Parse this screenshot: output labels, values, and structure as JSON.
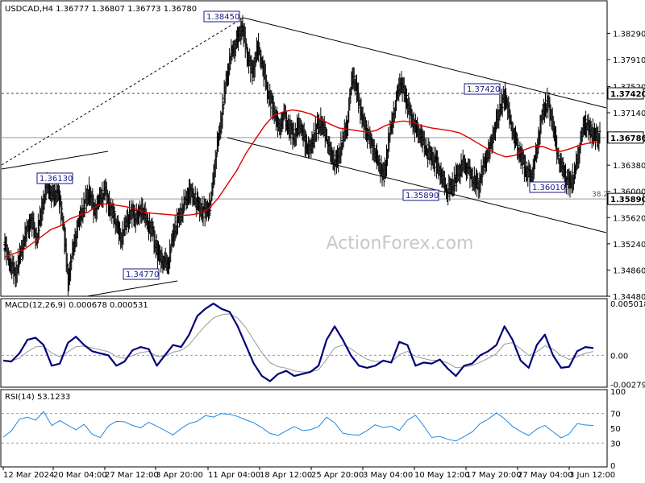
{
  "header": {
    "title": "USDCAD,H4  1.36777  1.36807  1.36773  1.36780",
    "watermark": "ActionForex.com"
  },
  "chart_data": [
    {
      "type": "candlestick",
      "title": "USDCAD,H4  1.36777  1.36807  1.36773  1.36780",
      "ylim": [
        1.3448,
        1.3875
      ],
      "y_ticks": [
        "1.38290",
        "1.37910",
        "1.37520",
        "1.37140",
        "1.36760",
        "1.36380",
        "1.36000",
        "1.35620",
        "1.35240",
        "1.34860",
        "1.34480"
      ],
      "x_ticks": [
        "12 Mar 2024",
        "20 Mar 04:00",
        "27 Mar 12:00",
        "3 Apr 20:00",
        "11 Apr 04:00",
        "18 Apr 12:00",
        "25 Apr 20:00",
        "3 May 04:00",
        "10 May 12:00",
        "17 May 20:00",
        "27 May 04:00",
        "3 Jun 12:00"
      ],
      "price_labels": [
        {
          "text": "1.38450",
          "value": 1.3845
        },
        {
          "text": "1.37420",
          "value": 1.3742
        },
        {
          "text": "1.36130",
          "value": 1.3613
        },
        {
          "text": "1.35890",
          "value": 1.3589
        },
        {
          "text": "1.36010",
          "value": 1.3601
        },
        {
          "text": "1.34770",
          "value": 1.3477
        }
      ],
      "right_tags": [
        {
          "text": "1.37420",
          "value": 1.3742
        },
        {
          "text": "1.36780",
          "value": 1.3678
        },
        {
          "text": "1.35890",
          "value": 1.3589
        }
      ],
      "fib_label": "38.2",
      "horizontal_lines": [
        {
          "value": 1.3742,
          "style": "dashed"
        },
        {
          "value": 1.3678,
          "style": "solid"
        },
        {
          "value": 1.3589,
          "style": "solid"
        }
      ],
      "close_series": [
        1.352,
        1.3495,
        1.348,
        1.351,
        1.354,
        1.356,
        1.353,
        1.3575,
        1.361,
        1.359,
        1.36,
        1.356,
        1.347,
        1.352,
        1.3555,
        1.358,
        1.36,
        1.357,
        1.359,
        1.36,
        1.3575,
        1.356,
        1.353,
        1.3555,
        1.357,
        1.356,
        1.3575,
        1.3555,
        1.354,
        1.351,
        1.35,
        1.3495,
        1.354,
        1.356,
        1.358,
        1.36,
        1.359,
        1.3575,
        1.357,
        1.358,
        1.365,
        1.37,
        1.376,
        1.38,
        1.3815,
        1.384,
        1.38,
        1.377,
        1.381,
        1.378,
        1.374,
        1.372,
        1.369,
        1.371,
        1.369,
        1.368,
        1.37,
        1.367,
        1.366,
        1.369,
        1.37,
        1.368,
        1.365,
        1.364,
        1.367,
        1.37,
        1.377,
        1.374,
        1.37,
        1.368,
        1.366,
        1.364,
        1.362,
        1.368,
        1.372,
        1.376,
        1.374,
        1.371,
        1.369,
        1.368,
        1.366,
        1.365,
        1.364,
        1.362,
        1.36,
        1.361,
        1.3625,
        1.364,
        1.363,
        1.3615,
        1.361,
        1.364,
        1.366,
        1.369,
        1.372,
        1.374,
        1.37,
        1.367,
        1.365,
        1.363,
        1.362,
        1.366,
        1.371,
        1.373,
        1.37,
        1.365,
        1.363,
        1.361,
        1.362,
        1.366,
        1.37,
        1.369,
        1.368,
        1.3678
      ],
      "ma_series": [
        1.3505,
        1.351,
        1.3515,
        1.3525,
        1.3535,
        1.3545,
        1.355,
        1.356,
        1.3565,
        1.357,
        1.358,
        1.3582,
        1.358,
        1.3578,
        1.3575,
        1.357,
        1.3568,
        1.3567,
        1.3566,
        1.3565,
        1.3566,
        1.3568,
        1.3575,
        1.359,
        1.361,
        1.363,
        1.3655,
        1.3675,
        1.3695,
        1.371,
        1.3715,
        1.3718,
        1.3716,
        1.3712,
        1.3705,
        1.3698,
        1.3692,
        1.369,
        1.3688,
        1.3686,
        1.3688,
        1.3695,
        1.37,
        1.3702,
        1.37,
        1.3695,
        1.3692,
        1.369,
        1.3688,
        1.3685,
        1.3678,
        1.367,
        1.3662,
        1.3655,
        1.365,
        1.3652,
        1.366,
        1.3665,
        1.3665,
        1.366,
        1.3658,
        1.3662,
        1.3667,
        1.367,
        1.3672
      ],
      "ma_x_range": [
        0.0,
        1.0
      ]
    },
    {
      "type": "line",
      "title": "MACD(12,26,9) 0.000678 0.000531",
      "ylim": [
        -0.003,
        0.0054
      ],
      "y_ticks": [
        "0.005018",
        "0.00",
        "-0.002795"
      ],
      "series": [
        {
          "values": [
            -0.0005,
            -0.0006,
            0.0002,
            0.0015,
            0.0017,
            0.001,
            -0.001,
            -0.0008,
            0.0012,
            0.0018,
            0.001,
            0.0004,
            0.0002,
            0.0,
            -0.001,
            -0.0006,
            0.0005,
            0.0008,
            0.0006,
            -0.001,
            0.0,
            0.001,
            0.0008,
            0.002,
            0.0038,
            0.0045,
            0.005,
            0.0045,
            0.0042,
            0.0028,
            0.001,
            -0.0008,
            -0.002,
            -0.0025,
            -0.0018,
            -0.0015,
            -0.002,
            -0.0018,
            -0.0016,
            -0.001,
            0.0015,
            0.0028,
            0.0015,
            0.0,
            -0.001,
            -0.0012,
            -0.001,
            -0.0005,
            -0.0007,
            0.0013,
            0.001,
            -0.001,
            -0.0007,
            -0.0008,
            -0.0004,
            -0.0013,
            -0.002,
            -0.001,
            -0.0008,
            0.0,
            0.0004,
            0.001,
            0.0028,
            0.0015,
            -0.0005,
            -0.0012,
            0.001,
            0.002,
            0.0,
            -0.0012,
            -0.0011,
            0.0004,
            0.0008,
            0.0007
          ]
        }
      ]
    },
    {
      "type": "line",
      "title": "RSI(14) 53.1233",
      "ylim": [
        0,
        100
      ],
      "y_ticks": [
        "100",
        "70",
        "50",
        "30",
        "0"
      ],
      "levels": [
        70,
        30
      ],
      "series": [
        {
          "values": [
            38,
            45,
            60,
            62,
            58,
            70,
            52,
            60,
            55,
            50,
            58,
            45,
            40,
            55,
            60,
            58,
            52,
            48,
            55,
            50,
            45,
            40,
            50,
            58,
            62,
            70,
            68,
            72,
            70,
            66,
            60,
            55,
            48,
            40,
            38,
            45,
            52,
            48,
            50,
            55,
            68,
            60,
            45,
            42,
            40,
            45,
            52,
            48,
            50,
            45,
            60,
            68,
            55,
            40,
            42,
            38,
            35,
            40,
            45,
            55,
            60,
            68,
            60,
            50,
            44,
            40,
            50,
            56,
            48,
            40,
            45,
            58,
            55,
            53
          ]
        }
      ]
    }
  ]
}
